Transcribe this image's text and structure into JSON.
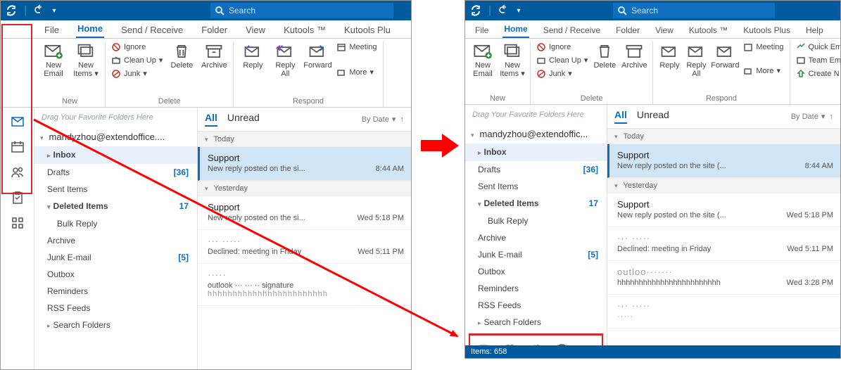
{
  "search_placeholder": "Search",
  "tabs": {
    "file": "File",
    "home": "Home",
    "send": "Send / Receive",
    "folder": "Folder",
    "view": "View",
    "kutools": "Kutools ™",
    "kutoolsplus_left": "Kutools Plu",
    "kutoolsplus_right": "Kutools Plus",
    "help": "Help"
  },
  "ribbon": {
    "new_group": "New",
    "new_email": "New Email",
    "new_items": "New Items",
    "delete_group": "Delete",
    "delete": "Delete",
    "archive": "Archive",
    "ignore": "Ignore",
    "cleanup": "Clean Up",
    "junk": "Junk",
    "respond_group": "Respond",
    "reply": "Reply",
    "reply_all": "Reply All",
    "forward": "Forward",
    "meeting": "Meeting",
    "more": "More",
    "quick_em": "Quick Em",
    "team_em": "Team Em",
    "create_n": "Create N"
  },
  "folders": {
    "fav_hint": "Drag Your Favorite Folders Here",
    "account_left": "mandyzhou@extendoffice....",
    "account_right": "mandyzhou@extendoffic...",
    "inbox": "Inbox",
    "drafts": "Drafts",
    "drafts_count": "[36]",
    "sent": "Sent Items",
    "deleted": "Deleted Items",
    "deleted_count": "17",
    "bulk": "Bulk Reply",
    "archive": "Archive",
    "junk": "Junk E-mail",
    "junk_count": "[5]",
    "outbox": "Outbox",
    "reminders": "Reminders",
    "rss": "RSS Feeds",
    "search_folders": "Search Folders"
  },
  "list": {
    "filter_all": "All",
    "filter_unread": "Unread",
    "sort": "By Date",
    "today": "Today",
    "yesterday": "Yesterday",
    "m1_from": "Support",
    "m1_sub": "New reply posted on the si...",
    "m1_time": "8:44 AM",
    "m1b_sub": "New reply posted on the site (...",
    "m2_from": "Support",
    "m2_sub_left": "New reply posted on the si...",
    "m2_sub_right": "New reply posted on the site (...",
    "m2_time": "Wed 5:18 PM",
    "m3_from": "··· ·····",
    "m3_sub": "Declined: meeting in Friday",
    "m3_time": "Wed 5:11 PM",
    "m4_from": "·····",
    "m4_from_right": "outloo·······",
    "m4_sub": "outlook ··· ··· ·· signature",
    "m4_sub_right": "hhhhhhhhhhhhhhhhhhhhhhhh",
    "m4_time": "Wed 3:28 PM",
    "m5_from": "··· ·····",
    "m5_sub": "hhhhhhhhhhhhhhhhhhhhhhhh"
  },
  "status": {
    "items": "Items: 658"
  }
}
